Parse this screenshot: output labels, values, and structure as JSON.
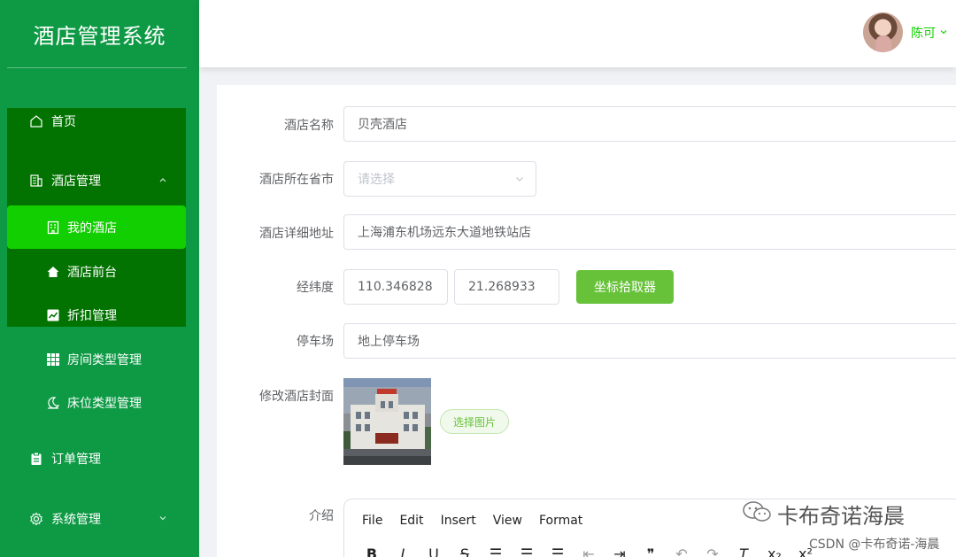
{
  "sidebar": {
    "title": "酒店管理系统",
    "menu": {
      "home": "首页",
      "hotel_mgmt": "酒店管理",
      "my_hotel": "我的酒店",
      "front_desk": "酒店前台",
      "discount": "折扣管理",
      "room_type": "房间类型管理",
      "bed_type": "床位类型管理",
      "orders": "订单管理",
      "system": "系统管理"
    }
  },
  "header": {
    "username": "陈可"
  },
  "form": {
    "hotel_name": {
      "label": "酒店名称",
      "value": "贝壳酒店"
    },
    "province": {
      "label": "酒店所在省市",
      "placeholder": "请选择"
    },
    "address": {
      "label": "酒店详细地址",
      "value": "上海浦东机场远东大道地铁站店"
    },
    "coords": {
      "label": "经纬度",
      "lng": "110.346828",
      "lat": "21.268933",
      "picker_button": "坐标拾取器"
    },
    "parking": {
      "label": "停车场",
      "value": "地上停车场"
    },
    "cover": {
      "label": "修改酒店封面",
      "choose_button": "选择图片"
    },
    "intro": {
      "label": "介绍",
      "editor_menu": [
        "File",
        "Edit",
        "Insert",
        "View",
        "Format"
      ]
    }
  },
  "watermarks": {
    "wechat": "卡布奇诺海晨",
    "csdn": "CSDN @卡布奇诺-海晨"
  },
  "colors": {
    "sidebar": "#0e9a45",
    "submenu": "#027300",
    "active": "#11cf00",
    "button": "#67c23a"
  }
}
